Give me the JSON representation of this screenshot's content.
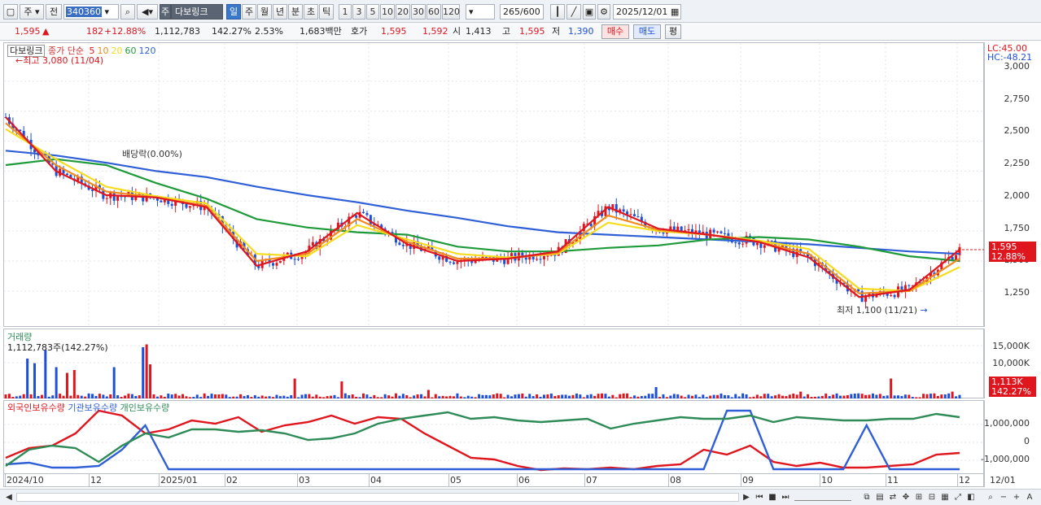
{
  "toolbar": {
    "period_label": "주",
    "prev_label": "전",
    "code": "340360",
    "stock_name_prefix": "주",
    "stock_name": "다보링크",
    "timeframes": [
      "일",
      "주",
      "월",
      "년",
      "분",
      "초",
      "틱"
    ],
    "active_timeframe": "일",
    "intervals": [
      "1",
      "3",
      "5",
      "10",
      "20",
      "30",
      "60",
      "120"
    ],
    "bar_count": "265",
    "bar_total": "/600",
    "date": "2025/12/01"
  },
  "infobar": {
    "price": "1,595",
    "change_symbol": "▲",
    "change": "182",
    "change_pct": "+12.88%",
    "volume": "1,112,783",
    "volume_ratio": "142.27%",
    "turnover": "2.53%",
    "amount": "1,683백만",
    "quote_label": "호가",
    "ask": "1,595",
    "bid": "1,592",
    "open_label": "시",
    "open": "1,413",
    "high_label": "고",
    "high": "1,595",
    "low_label": "저",
    "low": "1,390",
    "buy_label": "매수",
    "sell_label": "매도",
    "eval_label": "평"
  },
  "price_panel": {
    "name": "다보링크",
    "ma_title": "종가 단순",
    "ma_periods": [
      "5",
      "10",
      "20",
      "60",
      "120"
    ],
    "ma_colors": [
      "#e0161f",
      "#f08a1c",
      "#f5dc1e",
      "#1f9a3a",
      "#2f5fd6"
    ],
    "high_note": "←최고 3,080 (11/04)",
    "low_note": "최저 1,100 (11/21)",
    "low_arrow": "→",
    "dividend_note": "배당락(0.00%)",
    "lc": "LC:45.00",
    "hc": "HC:-48.21",
    "y_ticks": [
      "3,000",
      "2,750",
      "2,500",
      "2,250",
      "2,000",
      "1,750",
      "1,500",
      "1,250"
    ],
    "price_tag": "1,595",
    "pct_tag": "12.88%"
  },
  "volume_panel": {
    "title": "거래량",
    "value_text": "1,112,783주(142.27%)",
    "y_ticks": [
      "15,000K",
      "10,000K"
    ],
    "volume_tag": "1,113K",
    "pct_tag": "142.27%"
  },
  "holding_panel": {
    "legend": [
      "외국인보유수량",
      "기관보유수량",
      "개인보유수량"
    ],
    "colors": [
      "#e0161f",
      "#2f5fd6",
      "#2e8b57"
    ],
    "y_ticks": [
      "1,000,000",
      "0",
      "-1,000,000"
    ]
  },
  "x_axis": [
    "2024/10",
    "12",
    "2025/01",
    "02",
    "03",
    "04",
    "05",
    "06",
    "07",
    "08",
    "09",
    "10",
    "11",
    "12",
    "12/01"
  ],
  "colors": {
    "up": "#e0161f",
    "down": "#1d4fd8",
    "accent": "#3a78c9"
  },
  "chart_data": {
    "type": "line",
    "title": "다보링크",
    "x": [
      "2024/10",
      "12",
      "2025/01",
      "02",
      "03",
      "04",
      "05",
      "06",
      "07",
      "08",
      "09",
      "10",
      "11",
      "12"
    ],
    "ylim": [
      1100,
      3080
    ],
    "series": [
      {
        "name": "5",
        "values": [
          2700,
          2250,
          2050,
          2030,
          1950,
          1460,
          1580,
          1900,
          1640,
          1500,
          1520,
          1580,
          1950,
          1770,
          1720,
          1660,
          1530,
          1200,
          1260,
          1595
        ]
      },
      {
        "name": "10",
        "values": [
          2650,
          2300,
          2080,
          2030,
          1960,
          1500,
          1560,
          1850,
          1660,
          1520,
          1520,
          1570,
          1880,
          1760,
          1720,
          1660,
          1560,
          1230,
          1250,
          1520
        ]
      },
      {
        "name": "20",
        "values": [
          2600,
          2350,
          2120,
          2040,
          1980,
          1560,
          1540,
          1800,
          1680,
          1560,
          1530,
          1560,
          1820,
          1750,
          1720,
          1670,
          1600,
          1270,
          1250,
          1450
        ]
      },
      {
        "name": "60",
        "values": [
          2300,
          2350,
          2300,
          2150,
          2020,
          1850,
          1780,
          1740,
          1720,
          1620,
          1580,
          1580,
          1610,
          1630,
          1680,
          1700,
          1680,
          1620,
          1540,
          1500
        ]
      },
      {
        "name": "120",
        "values": [
          2420,
          2380,
          2320,
          2250,
          2200,
          2120,
          2050,
          1990,
          1920,
          1860,
          1790,
          1740,
          1720,
          1700,
          1680,
          1660,
          1640,
          1610,
          1580,
          1560
        ]
      }
    ],
    "price_high": 3080,
    "price_low": 1100,
    "last_price": 1595
  }
}
